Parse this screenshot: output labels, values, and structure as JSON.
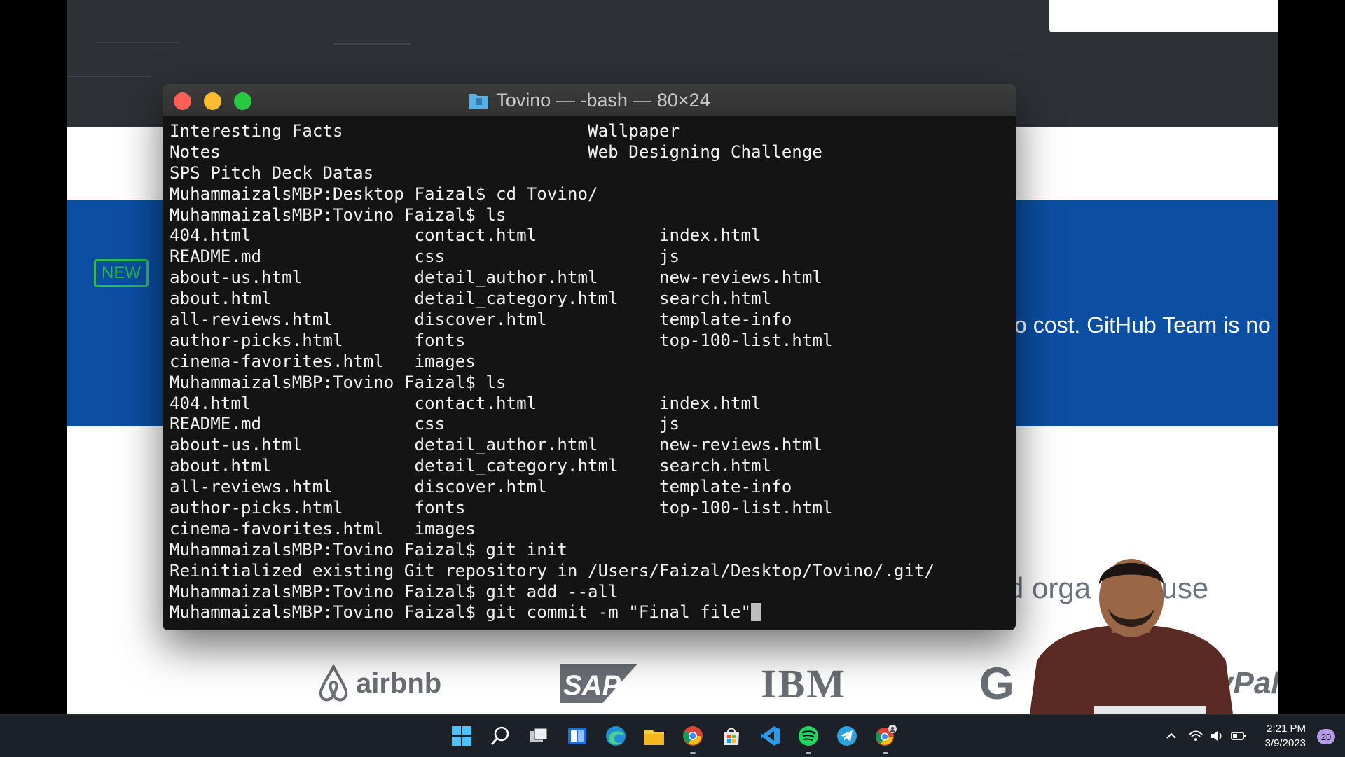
{
  "webpage": {
    "new_badge": "NEW",
    "banner_text": "o cost. GitHub Team is no",
    "partial_text": "d orga  ions use",
    "logos": [
      "airbnb",
      "SAP",
      "IBM",
      "G",
      "yPal"
    ]
  },
  "terminal": {
    "title": "Tovino — -bash — 80×24",
    "lines": [
      "Interesting Facts                        Wallpaper",
      "Notes                                    Web Designing Challenge",
      "SPS Pitch Deck Datas",
      "MuhammaizalsMBP:Desktop Faizal$ cd Tovino/",
      "MuhammaizalsMBP:Tovino Faizal$ ls",
      "404.html                contact.html            index.html",
      "README.md               css                     js",
      "about-us.html           detail_author.html      new-reviews.html",
      "about.html              detail_category.html    search.html",
      "all-reviews.html        discover.html           template-info",
      "author-picks.html       fonts                   top-100-list.html",
      "cinema-favorites.html   images",
      "MuhammaizalsMBP:Tovino Faizal$ ls",
      "404.html                contact.html            index.html",
      "README.md               css                     js",
      "about-us.html           detail_author.html      new-reviews.html",
      "about.html              detail_category.html    search.html",
      "all-reviews.html        discover.html           template-info",
      "author-picks.html       fonts                   top-100-list.html",
      "cinema-favorites.html   images",
      "MuhammaizalsMBP:Tovino Faizal$ git init",
      "Reinitialized existing Git repository in /Users/Faizal/Desktop/Tovino/.git/",
      "MuhammaizalsMBP:Tovino Faizal$ git add --all",
      "MuhammaizalsMBP:Tovino Faizal$ git commit -m \"Final file\""
    ]
  },
  "taskbar": {
    "apps": [
      "start-icon",
      "search-icon",
      "task-view-icon",
      "widgets-icon",
      "edge-icon",
      "file-explorer-icon",
      "chrome-icon",
      "microsoft-store-icon",
      "vscode-icon",
      "spotify-icon",
      "telegram-icon",
      "chrome-profile-icon"
    ],
    "time": "2:21 PM",
    "date": "3/9/2023",
    "notification_count": "20"
  }
}
